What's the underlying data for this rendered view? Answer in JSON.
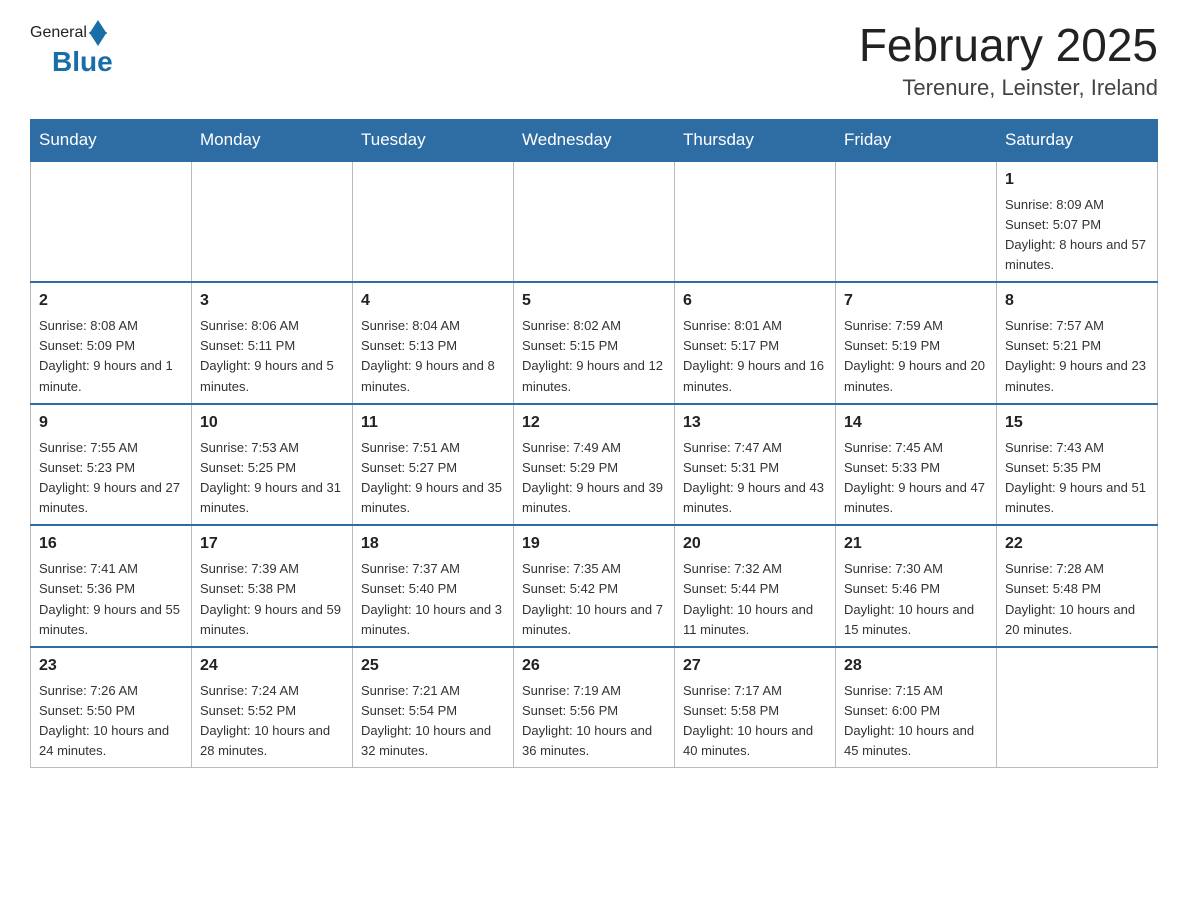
{
  "header": {
    "logo_general": "General",
    "logo_blue": "Blue",
    "month_title": "February 2025",
    "location": "Terenure, Leinster, Ireland"
  },
  "days_of_week": [
    "Sunday",
    "Monday",
    "Tuesday",
    "Wednesday",
    "Thursday",
    "Friday",
    "Saturday"
  ],
  "weeks": [
    [
      {
        "day": "",
        "info": ""
      },
      {
        "day": "",
        "info": ""
      },
      {
        "day": "",
        "info": ""
      },
      {
        "day": "",
        "info": ""
      },
      {
        "day": "",
        "info": ""
      },
      {
        "day": "",
        "info": ""
      },
      {
        "day": "1",
        "info": "Sunrise: 8:09 AM\nSunset: 5:07 PM\nDaylight: 8 hours and 57 minutes."
      }
    ],
    [
      {
        "day": "2",
        "info": "Sunrise: 8:08 AM\nSunset: 5:09 PM\nDaylight: 9 hours and 1 minute."
      },
      {
        "day": "3",
        "info": "Sunrise: 8:06 AM\nSunset: 5:11 PM\nDaylight: 9 hours and 5 minutes."
      },
      {
        "day": "4",
        "info": "Sunrise: 8:04 AM\nSunset: 5:13 PM\nDaylight: 9 hours and 8 minutes."
      },
      {
        "day": "5",
        "info": "Sunrise: 8:02 AM\nSunset: 5:15 PM\nDaylight: 9 hours and 12 minutes."
      },
      {
        "day": "6",
        "info": "Sunrise: 8:01 AM\nSunset: 5:17 PM\nDaylight: 9 hours and 16 minutes."
      },
      {
        "day": "7",
        "info": "Sunrise: 7:59 AM\nSunset: 5:19 PM\nDaylight: 9 hours and 20 minutes."
      },
      {
        "day": "8",
        "info": "Sunrise: 7:57 AM\nSunset: 5:21 PM\nDaylight: 9 hours and 23 minutes."
      }
    ],
    [
      {
        "day": "9",
        "info": "Sunrise: 7:55 AM\nSunset: 5:23 PM\nDaylight: 9 hours and 27 minutes."
      },
      {
        "day": "10",
        "info": "Sunrise: 7:53 AM\nSunset: 5:25 PM\nDaylight: 9 hours and 31 minutes."
      },
      {
        "day": "11",
        "info": "Sunrise: 7:51 AM\nSunset: 5:27 PM\nDaylight: 9 hours and 35 minutes."
      },
      {
        "day": "12",
        "info": "Sunrise: 7:49 AM\nSunset: 5:29 PM\nDaylight: 9 hours and 39 minutes."
      },
      {
        "day": "13",
        "info": "Sunrise: 7:47 AM\nSunset: 5:31 PM\nDaylight: 9 hours and 43 minutes."
      },
      {
        "day": "14",
        "info": "Sunrise: 7:45 AM\nSunset: 5:33 PM\nDaylight: 9 hours and 47 minutes."
      },
      {
        "day": "15",
        "info": "Sunrise: 7:43 AM\nSunset: 5:35 PM\nDaylight: 9 hours and 51 minutes."
      }
    ],
    [
      {
        "day": "16",
        "info": "Sunrise: 7:41 AM\nSunset: 5:36 PM\nDaylight: 9 hours and 55 minutes."
      },
      {
        "day": "17",
        "info": "Sunrise: 7:39 AM\nSunset: 5:38 PM\nDaylight: 9 hours and 59 minutes."
      },
      {
        "day": "18",
        "info": "Sunrise: 7:37 AM\nSunset: 5:40 PM\nDaylight: 10 hours and 3 minutes."
      },
      {
        "day": "19",
        "info": "Sunrise: 7:35 AM\nSunset: 5:42 PM\nDaylight: 10 hours and 7 minutes."
      },
      {
        "day": "20",
        "info": "Sunrise: 7:32 AM\nSunset: 5:44 PM\nDaylight: 10 hours and 11 minutes."
      },
      {
        "day": "21",
        "info": "Sunrise: 7:30 AM\nSunset: 5:46 PM\nDaylight: 10 hours and 15 minutes."
      },
      {
        "day": "22",
        "info": "Sunrise: 7:28 AM\nSunset: 5:48 PM\nDaylight: 10 hours and 20 minutes."
      }
    ],
    [
      {
        "day": "23",
        "info": "Sunrise: 7:26 AM\nSunset: 5:50 PM\nDaylight: 10 hours and 24 minutes."
      },
      {
        "day": "24",
        "info": "Sunrise: 7:24 AM\nSunset: 5:52 PM\nDaylight: 10 hours and 28 minutes."
      },
      {
        "day": "25",
        "info": "Sunrise: 7:21 AM\nSunset: 5:54 PM\nDaylight: 10 hours and 32 minutes."
      },
      {
        "day": "26",
        "info": "Sunrise: 7:19 AM\nSunset: 5:56 PM\nDaylight: 10 hours and 36 minutes."
      },
      {
        "day": "27",
        "info": "Sunrise: 7:17 AM\nSunset: 5:58 PM\nDaylight: 10 hours and 40 minutes."
      },
      {
        "day": "28",
        "info": "Sunrise: 7:15 AM\nSunset: 6:00 PM\nDaylight: 10 hours and 45 minutes."
      },
      {
        "day": "",
        "info": ""
      }
    ]
  ]
}
